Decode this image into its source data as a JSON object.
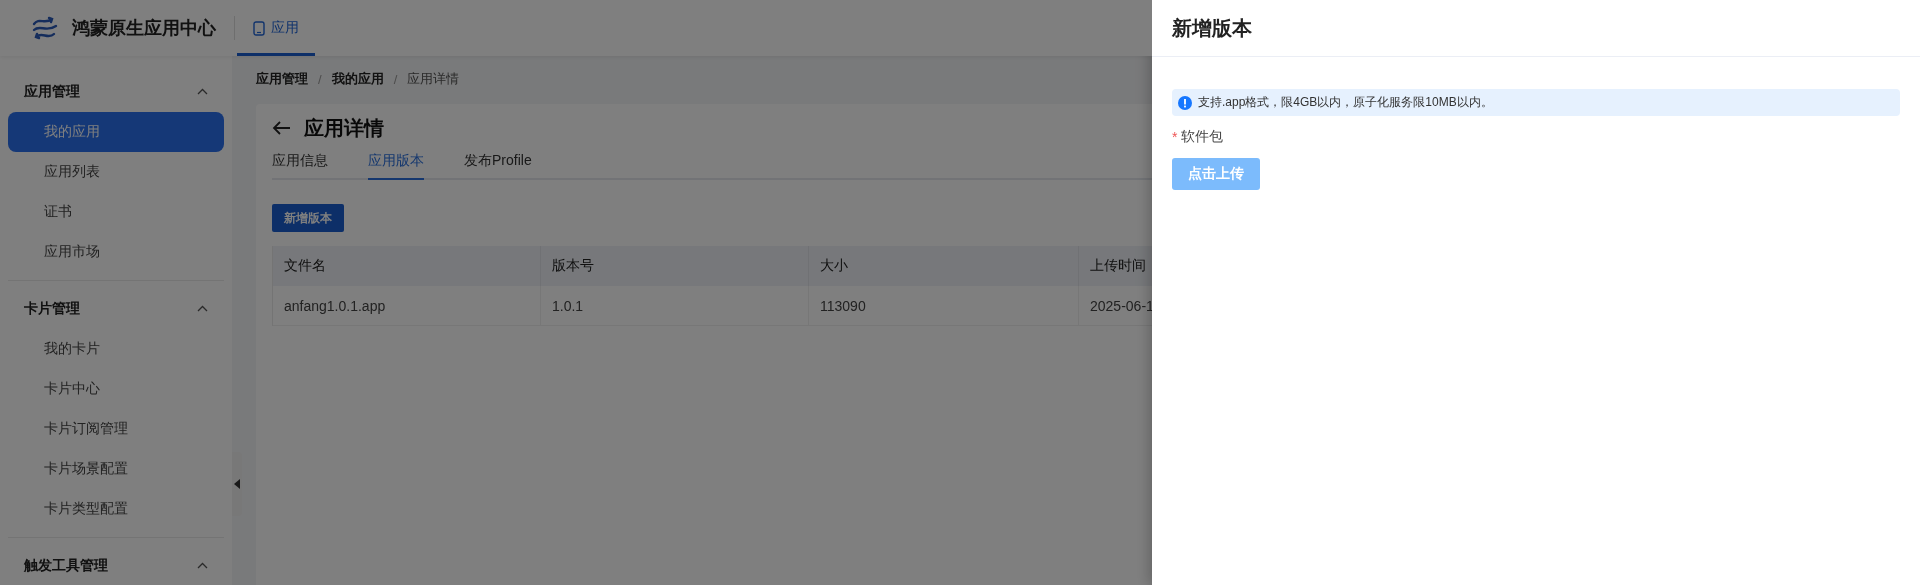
{
  "header": {
    "title": "鸿蒙原生应用中心",
    "nav_tabs": [
      {
        "label": "应用",
        "selected": true
      }
    ]
  },
  "sidebar": {
    "groups": [
      {
        "title": "应用管理",
        "expanded": true,
        "items": [
          {
            "label": "我的应用",
            "selected": true
          },
          {
            "label": "应用列表",
            "selected": false
          },
          {
            "label": "证书",
            "selected": false
          },
          {
            "label": "应用市场",
            "selected": false
          }
        ]
      },
      {
        "title": "卡片管理",
        "expanded": true,
        "items": [
          {
            "label": "我的卡片",
            "selected": false
          },
          {
            "label": "卡片中心",
            "selected": false
          },
          {
            "label": "卡片订阅管理",
            "selected": false
          },
          {
            "label": "卡片场景配置",
            "selected": false
          },
          {
            "label": "卡片类型配置",
            "selected": false
          }
        ]
      },
      {
        "title": "触发工具管理",
        "expanded": true
      }
    ]
  },
  "breadcrumb": {
    "separator": "/",
    "items": [
      "应用管理",
      "我的应用",
      "应用详情"
    ]
  },
  "page": {
    "title": "应用详情",
    "tabs": [
      {
        "label": "应用信息",
        "selected": false
      },
      {
        "label": "应用版本",
        "selected": true
      },
      {
        "label": "发布Profile",
        "selected": false
      }
    ],
    "add_button": "新增版本",
    "table": {
      "columns": [
        "文件名",
        "版本号",
        "大小",
        "上传时间"
      ],
      "rows": [
        [
          "anfang1.0.1.app",
          "1.0.1",
          "113090",
          "2025-06-1"
        ]
      ]
    }
  },
  "drawer": {
    "title": "新增版本",
    "notice": "支持.app格式，限4GB以内，原子化服务限10MB以内。",
    "field": {
      "label": "软件包",
      "required": true,
      "required_mark": "*"
    },
    "upload_button": "点击上传"
  }
}
